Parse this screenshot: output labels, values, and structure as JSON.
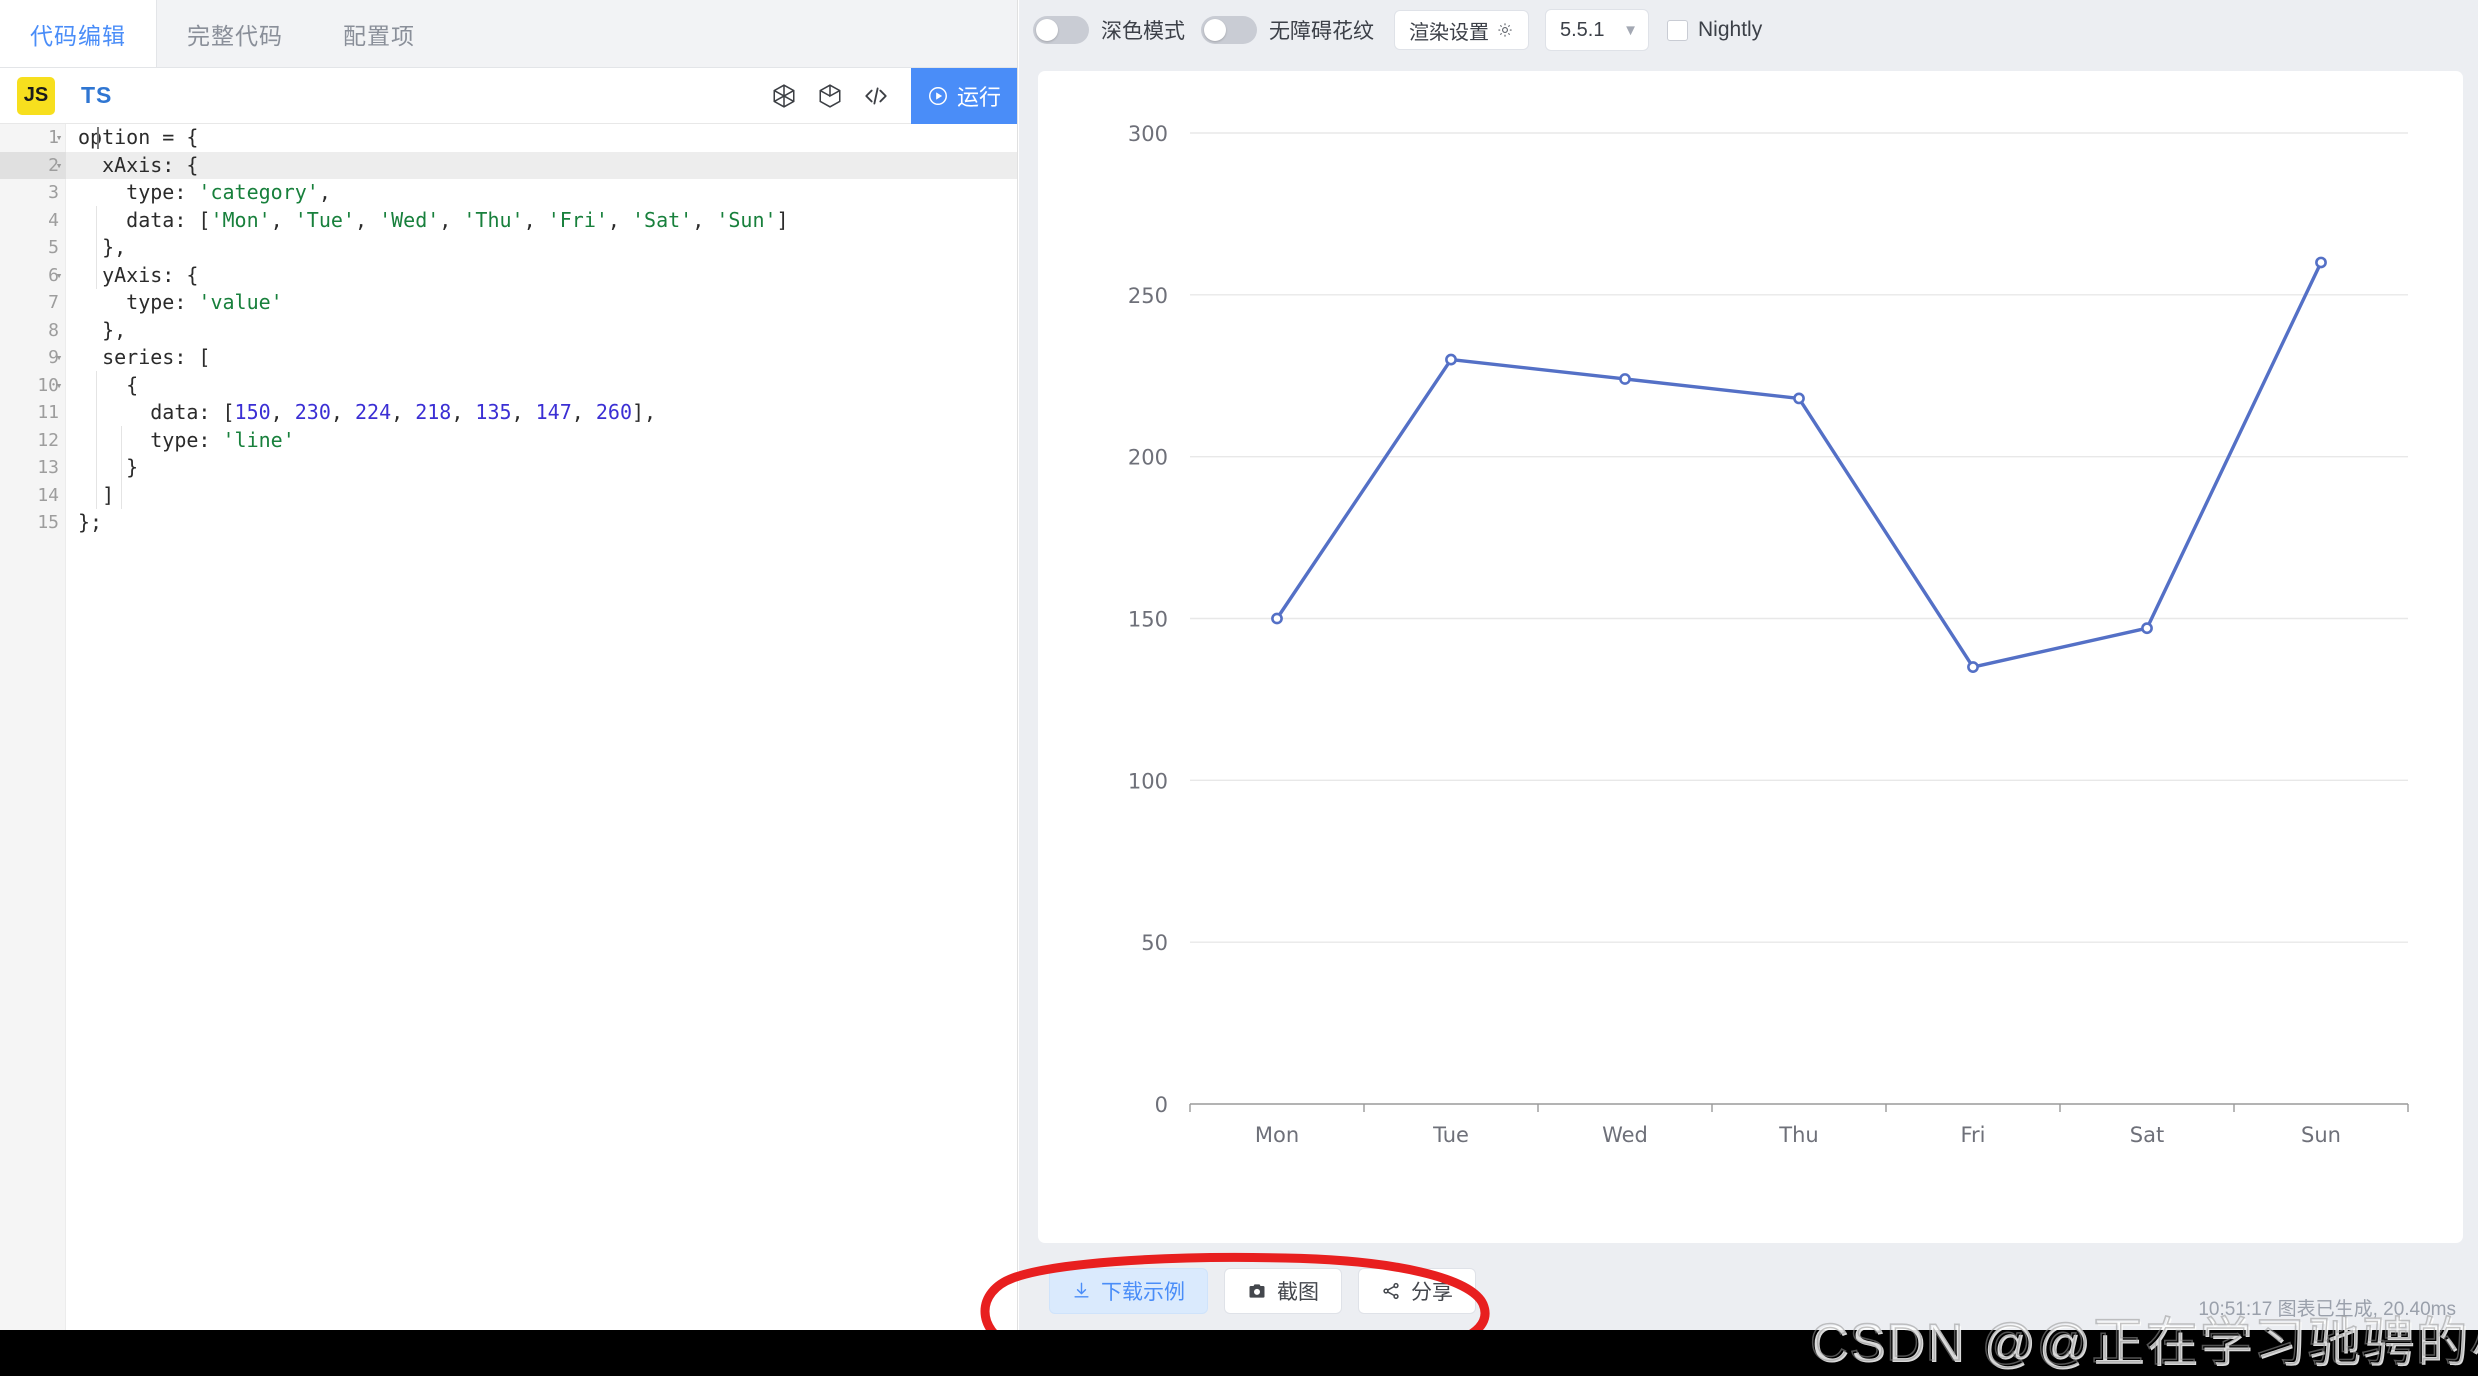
{
  "editor": {
    "tabs": [
      {
        "label": "代码编辑",
        "active": true
      },
      {
        "label": "完整代码",
        "active": false
      },
      {
        "label": "配置项",
        "active": false
      }
    ],
    "lang_js": "JS",
    "lang_ts": "TS",
    "toolbar_icons": [
      "wireframe-cube-icon",
      "cube-icon",
      "code-brackets-icon"
    ],
    "run_label": "运行",
    "active_line": 2,
    "lines": [
      {
        "n": "1",
        "fold": "▾",
        "code": "option = {"
      },
      {
        "n": "2",
        "fold": "▾",
        "code": "  xAxis: {"
      },
      {
        "n": "3",
        "fold": "",
        "code": "    type: 'category',"
      },
      {
        "n": "4",
        "fold": "",
        "code": "    data: ['Mon', 'Tue', 'Wed', 'Thu', 'Fri', 'Sat', 'Sun']"
      },
      {
        "n": "5",
        "fold": "",
        "code": "  },"
      },
      {
        "n": "6",
        "fold": "▾",
        "code": "  yAxis: {"
      },
      {
        "n": "7",
        "fold": "",
        "code": "    type: 'value'"
      },
      {
        "n": "8",
        "fold": "",
        "code": "  },"
      },
      {
        "n": "9",
        "fold": "▾",
        "code": "  series: ["
      },
      {
        "n": "10",
        "fold": "▾",
        "code": "    {"
      },
      {
        "n": "11",
        "fold": "",
        "code": "      data: [150, 230, 224, 218, 135, 147, 260],"
      },
      {
        "n": "12",
        "fold": "",
        "code": "      type: 'line'"
      },
      {
        "n": "13",
        "fold": "",
        "code": "    }"
      },
      {
        "n": "14",
        "fold": "",
        "code": "  ]"
      },
      {
        "n": "15",
        "fold": "",
        "code": "};"
      }
    ]
  },
  "preview": {
    "toolbar": {
      "dark_mode_label": "深色模式",
      "dark_mode_on": false,
      "pattern_label": "无障碍花纹",
      "pattern_on": false,
      "render_settings_label": "渲染设置",
      "version_value": "5.5.1",
      "nightly_label": "Nightly",
      "nightly_checked": false
    },
    "actions": [
      {
        "label": "下载示例",
        "icon": "download-icon",
        "primary": true
      },
      {
        "label": "截图",
        "icon": "camera-icon",
        "primary": false
      },
      {
        "label": "分享",
        "icon": "share-icon",
        "primary": false
      }
    ],
    "status": "10:51:17  图表已生成, 20.40ms"
  },
  "watermark": "CSDN @@正在学习驰骋的小马",
  "colors": {
    "accent": "#4a8df8",
    "series_line": "#5470c6",
    "annotation": "#e81f1f",
    "tab_active_text": "#4a8df8",
    "js_badge": "#f7df1e"
  },
  "chart_data": {
    "type": "line",
    "title": "",
    "xlabel": "",
    "ylabel": "",
    "categories": [
      "Mon",
      "Tue",
      "Wed",
      "Thu",
      "Fri",
      "Sat",
      "Sun"
    ],
    "values": [
      150,
      230,
      224,
      218,
      135,
      147,
      260
    ],
    "series": [
      {
        "name": "",
        "values": [
          150,
          230,
          224,
          218,
          135,
          147,
          260
        ]
      }
    ],
    "ylim": [
      0,
      300
    ],
    "yticks": [
      0,
      50,
      100,
      150,
      200,
      250,
      300
    ],
    "grid": true,
    "legend": "none",
    "line_color": "#5470c6",
    "symbol": "empty-circle"
  }
}
